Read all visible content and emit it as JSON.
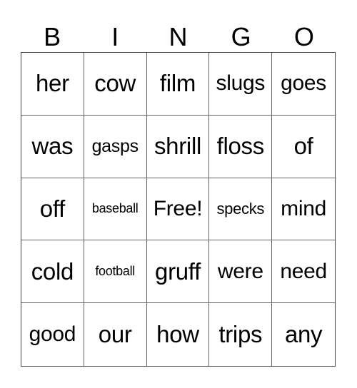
{
  "header": [
    "B",
    "I",
    "N",
    "G",
    "O"
  ],
  "cells": [
    "her",
    "cow",
    "film",
    "slugs",
    "goes",
    "was",
    "gasps",
    "shrill",
    "floss",
    "of",
    "off",
    "baseball",
    "Free!",
    "specks",
    "mind",
    "cold",
    "football",
    "gruff",
    "were",
    "need",
    "good",
    "our",
    "how",
    "trips",
    "any"
  ]
}
